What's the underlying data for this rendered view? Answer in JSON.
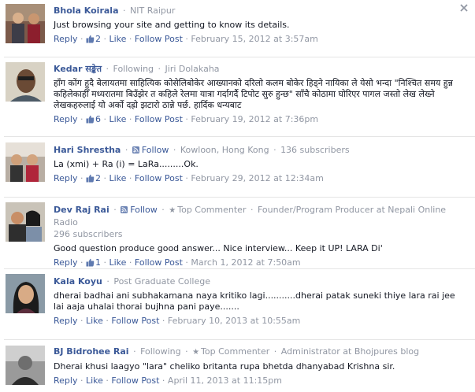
{
  "close_symbol": "×",
  "separator": "·",
  "labels": {
    "reply": "Reply",
    "like": "Like",
    "follow_post": "Follow Post",
    "follow": "Follow",
    "following": "Following",
    "top_commenter": "Top Commenter"
  },
  "comments": [
    {
      "author": "Bhola Koirala",
      "meta": "NIT Raipur",
      "text": "Just browsing your site and getting to know its details.",
      "likes": "2",
      "date": "February 15, 2012 at 3:57am"
    },
    {
      "author": "Kedar सङ्केत",
      "status": "Following",
      "meta": "Jiri Dolakaha",
      "text": "हाँग कोंग हुदै बेलायतमा साहित्यिक कोसेलिबोकेर आख्यानको दरिलो कलम बोकेर हिड्ने नायिका ले येसो भन्दा \"निश्चित समय हुन्न कहिलेकाहीँ मध्यरातमा बिउँझेर त कहिले रेलमा यात्रा गर्दागर्दै टिपोट सुरु हुन्छ\" साँचै कोठामा घोरिएर पागल जस्तो लेख लेख्ने लेखकहरुलाई यो अर्को दह्रो झटारो ठान्ने पर्छ. हार्दिक धन्यबाट",
      "likes": "6",
      "date": "February 19, 2012 at 7:36pm"
    },
    {
      "author": "Hari Shrestha",
      "follow": "Follow",
      "meta": "Kowloon, Hong Kong",
      "subscribers": "136 subscribers",
      "text": "La (xmi) + Ra (i) = LaRa.........Ok.",
      "likes": "2",
      "date": "February 29, 2012 at 12:34am"
    },
    {
      "author": "Dev Raj Rai",
      "follow": "Follow",
      "badge": "Top Commenter",
      "meta": "Founder/Program Producer at Nepali Online Radio",
      "subscribers": "296 subscribers",
      "text": "Good question produce good answer... Nice interview... Keep it UP! LARA Di'",
      "likes": "1",
      "date": "March 1, 2012 at 7:50am"
    },
    {
      "author": "Kala Koyu",
      "meta": "Post Graduate College",
      "text": "dherai badhai ani subhakamana naya kritiko lagi...........dherai patak suneki thiye lara rai jee lai aaja uhalai thorai bujhna pani paye.......",
      "date": "February 10, 2013 at 10:55am"
    },
    {
      "author": "BJ Bidrohee Rai",
      "status": "Following",
      "badge": "Top Commenter",
      "meta": "Administrator at Bhojpures blog",
      "text": "Dherai khusi laagyo \"lara\" cheliko britanta rupa bhetda dhanyabad Krishna sir.",
      "date": "April 11, 2013 at 11:15pm"
    }
  ]
}
